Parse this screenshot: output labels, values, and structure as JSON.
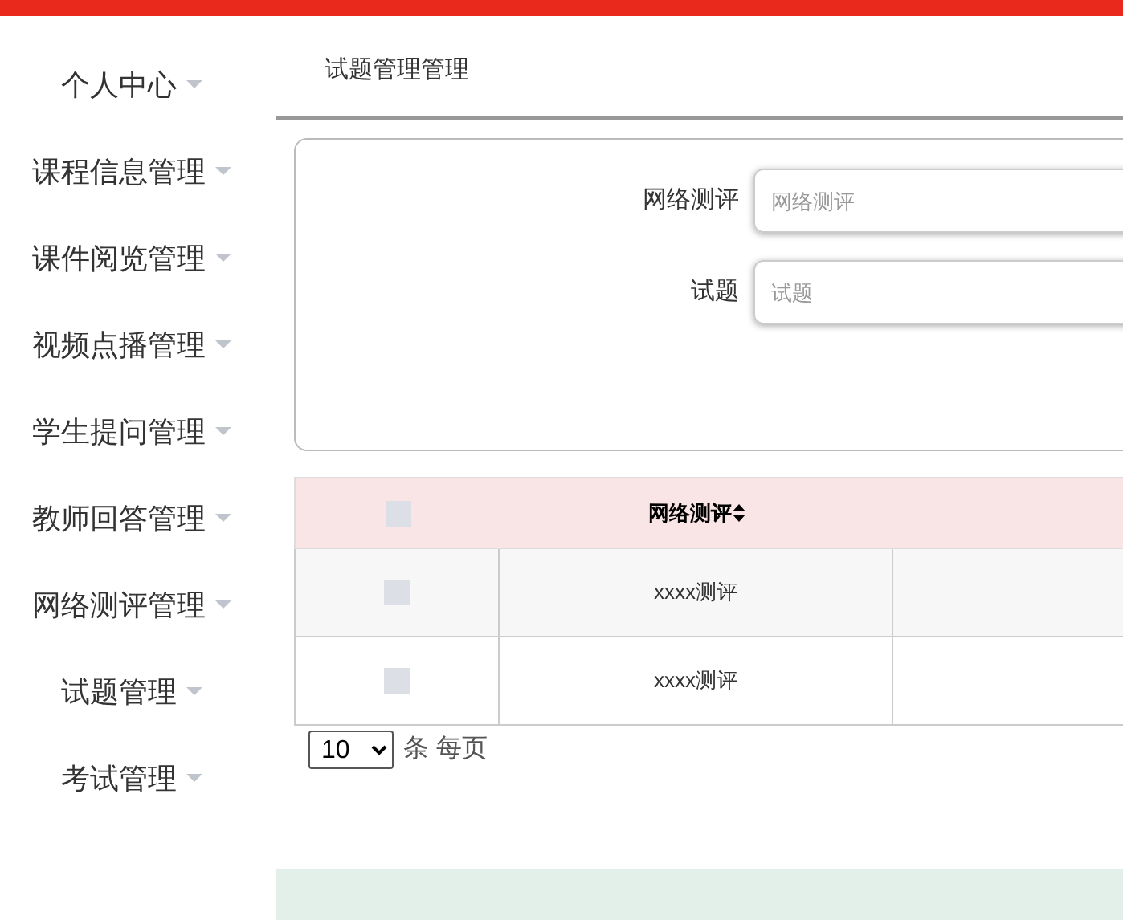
{
  "sidebar": {
    "items": [
      {
        "label": "个人中心"
      },
      {
        "label": "课程信息管理"
      },
      {
        "label": "课件阅览管理"
      },
      {
        "label": "视频点播管理"
      },
      {
        "label": "学生提问管理"
      },
      {
        "label": "教师回答管理"
      },
      {
        "label": "网络测评管理"
      },
      {
        "label": "试题管理"
      },
      {
        "label": "考试管理"
      }
    ]
  },
  "page_title": "试题管理管理",
  "search": {
    "fields": [
      {
        "label": "网络测评",
        "placeholder": "网络测评"
      },
      {
        "label": "试题",
        "placeholder": "试题"
      }
    ]
  },
  "table": {
    "header_checkbox": {
      "checked": false
    },
    "columns": [
      "网络测评"
    ],
    "rows": [
      {
        "checked": false,
        "cells": [
          "xxxx测评"
        ]
      },
      {
        "checked": false,
        "cells": [
          "xxxx测评"
        ]
      }
    ]
  },
  "pagination": {
    "page_size": "10",
    "label": "条 每页"
  }
}
